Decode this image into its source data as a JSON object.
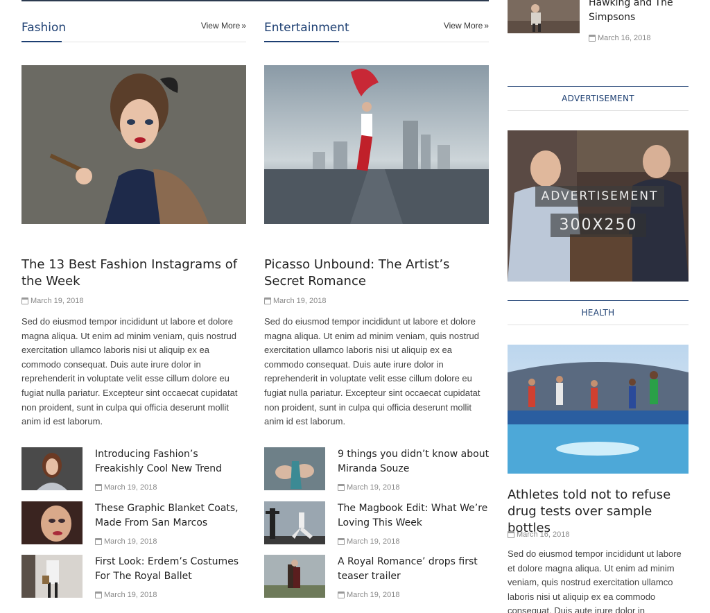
{
  "sections": {
    "fashion": {
      "title": "Fashion",
      "view_more": "View More",
      "featured": {
        "title": "The 13 Best Fashion Instagrams of the Week",
        "date": "March 19, 2018",
        "excerpt": "Sed do eiusmod tempor incididunt ut labore et dolore magna aliqua. Ut enim ad minim veniam, quis nostrud exercitation ullamco laboris nisi ut aliquip ex ea commodo consequat. Duis aute irure dolor in reprehenderit in voluptate velit esse cillum dolore eu fugiat nulla pariatur. Excepteur sint occaecat cupidatat non proident, sunt in culpa qui officia deserunt mollit anim id est laborum."
      },
      "items": [
        {
          "title": "Introducing Fashion’s Freakishly Cool New Trend",
          "date": "March 19, 2018"
        },
        {
          "title": "These Graphic Blanket Coats, Made From San Marcos",
          "date": "March 19, 2018"
        },
        {
          "title": "First Look: Erdem’s Costumes For The Royal Ballet",
          "date": "March 19, 2018"
        }
      ]
    },
    "entertainment": {
      "title": "Entertainment",
      "view_more": "View More",
      "featured": {
        "title": "Picasso Unbound: The Artist’s Secret Romance",
        "date": "March 19, 2018",
        "excerpt": "Sed do eiusmod tempor incididunt ut labore et dolore magna aliqua. Ut enim ad minim veniam, quis nostrud exercitation ullamco laboris nisi ut aliquip ex ea commodo consequat. Duis aute irure dolor in reprehenderit in voluptate velit esse cillum dolore eu fugiat nulla pariatur. Excepteur sint occaecat cupidatat non proident, sunt in culpa qui officia deserunt mollit anim id est laborum."
      },
      "items": [
        {
          "title": "9 things you didn’t know about Miranda Souze",
          "date": "March 19, 2018"
        },
        {
          "title": "The Magbook Edit: What We’re Loving This Week",
          "date": "March 19, 2018"
        },
        {
          "title": "A Royal Romance’ drops first teaser trailer",
          "date": "March 19, 2018"
        }
      ]
    }
  },
  "sidebar": {
    "top_item": {
      "title": "Hawking and The Simpsons",
      "date": "March 16, 2018"
    },
    "ad_widget": {
      "heading": "ADVERTISEMENT",
      "ad_label": "ADVERTISEMENT",
      "ad_size": "300X250"
    },
    "health_widget": {
      "heading": "HEALTH",
      "title": "Athletes told not to refuse drug tests over sample bottles",
      "date": "March 16, 2018",
      "excerpt": "Sed do eiusmod tempor incididunt ut labore et dolore magna aliqua. Ut enim ad minim veniam, quis nostrud exercitation ullamco laboris nisi ut aliquip ex ea commodo consequat. Duis aute irure dolor in"
    }
  },
  "colors": {
    "accent": "#1d3f72",
    "text": "#222222",
    "meta": "#888888"
  },
  "icons": {
    "date": "calendar-icon",
    "view_more": "double-chevron-right-icon"
  }
}
